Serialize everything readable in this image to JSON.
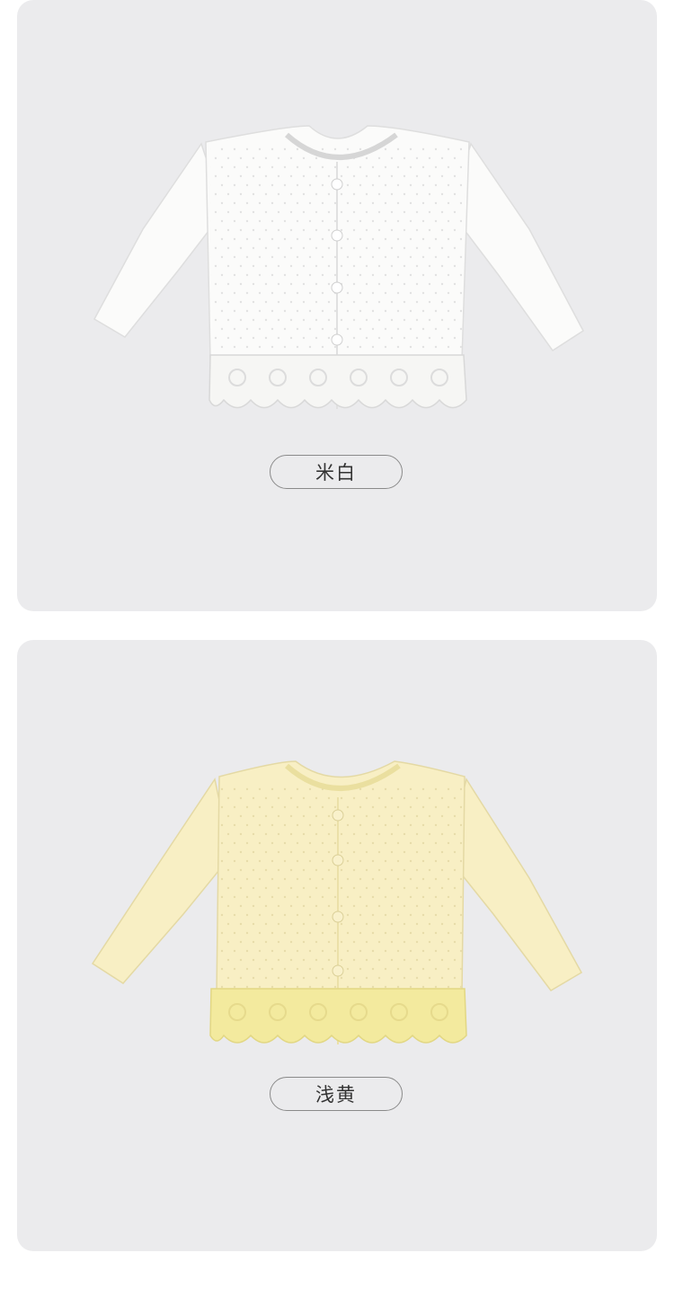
{
  "variants": [
    {
      "label": "米白",
      "icon": "cardigan-image",
      "garment_color": "#fbfbfa",
      "lace_color": "#f6f6f4",
      "shade_color": "#dedede"
    },
    {
      "label": "浅黄",
      "icon": "cardigan-image",
      "garment_color": "#f8efc4",
      "lace_color": "#f3ea9e",
      "shade_color": "#e4d9a4"
    }
  ],
  "card_background": "#ebebed"
}
